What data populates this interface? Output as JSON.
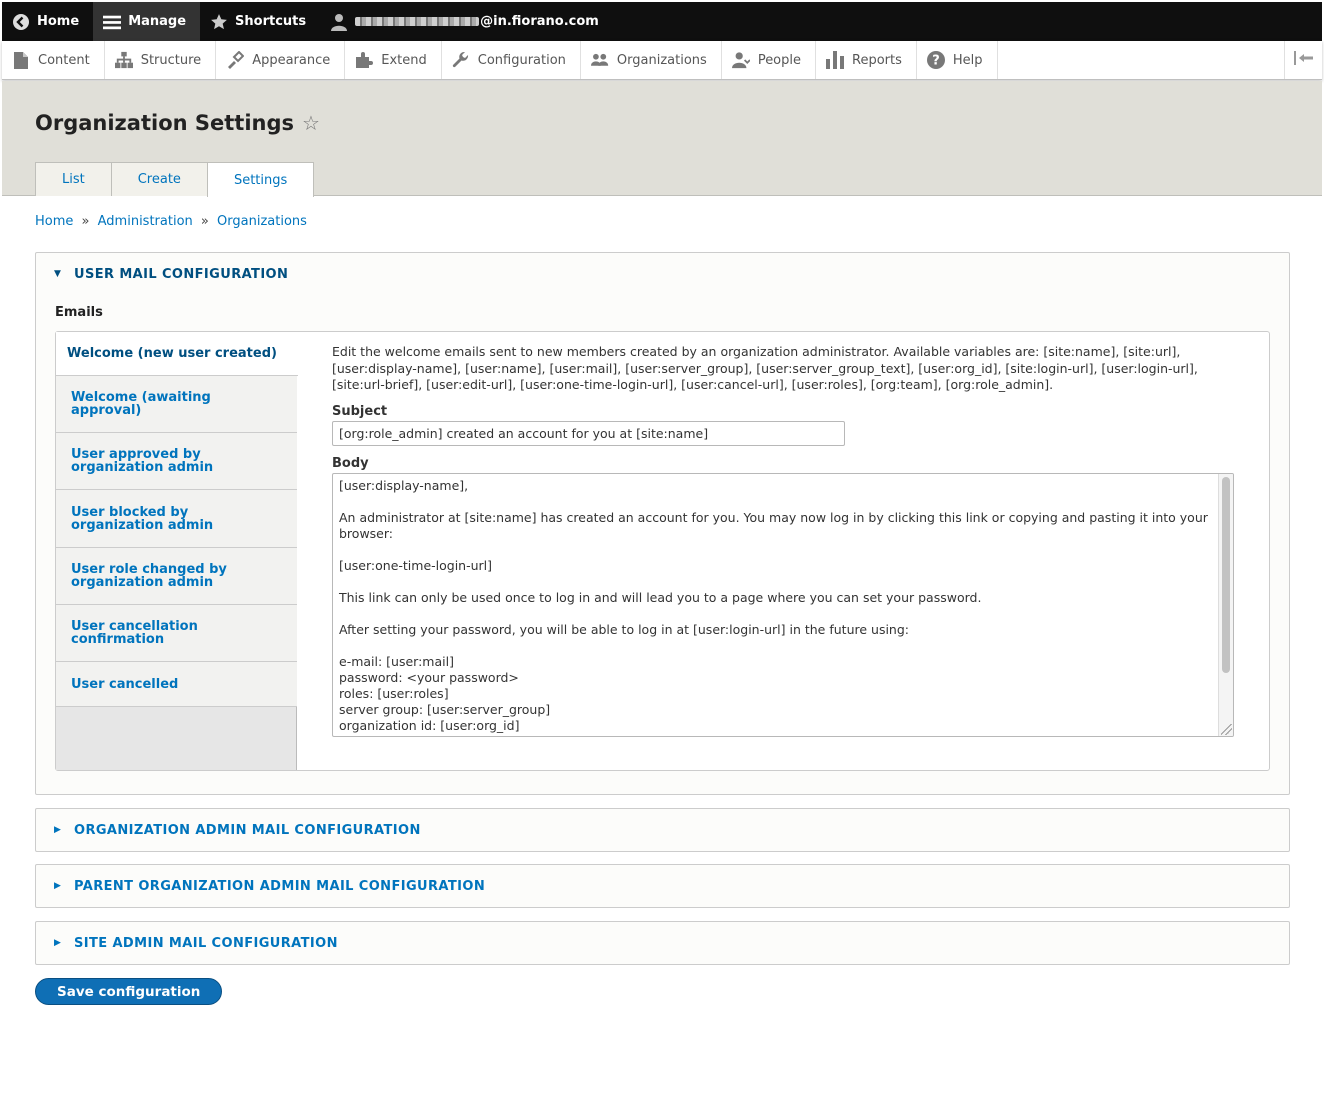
{
  "toolbar": {
    "home_label": "Home",
    "manage_label": "Manage",
    "shortcuts_label": "Shortcuts",
    "user_email_suffix": "@in.fiorano.com"
  },
  "tray": {
    "items": [
      {
        "label": "Content",
        "icon": "file-icon"
      },
      {
        "label": "Structure",
        "icon": "sitemap-icon"
      },
      {
        "label": "Appearance",
        "icon": "paintbrush-icon"
      },
      {
        "label": "Extend",
        "icon": "puzzle-icon"
      },
      {
        "label": "Configuration",
        "icon": "wrench-icon"
      },
      {
        "label": "Organizations",
        "icon": "people-group-icon"
      },
      {
        "label": "People",
        "icon": "person-icon"
      },
      {
        "label": "Reports",
        "icon": "bar-chart-icon"
      },
      {
        "label": "Help",
        "icon": "help-icon"
      }
    ]
  },
  "header": {
    "title": "Organization Settings",
    "tabs": [
      {
        "label": "List"
      },
      {
        "label": "Create"
      },
      {
        "label": "Settings"
      }
    ]
  },
  "breadcrumb": {
    "items": [
      "Home",
      "Administration",
      "Organizations"
    ],
    "separator": "»"
  },
  "user_mail": {
    "title": "USER MAIL CONFIGURATION",
    "emails_label": "Emails",
    "tabs": [
      {
        "label": "Welcome (new user created)"
      },
      {
        "label": "Welcome (awaiting approval)"
      },
      {
        "label": "User approved by organization admin"
      },
      {
        "label": "User blocked by organization admin"
      },
      {
        "label": "User role changed by organization admin"
      },
      {
        "label": "User cancellation confirmation"
      },
      {
        "label": "User cancelled"
      }
    ],
    "description": "Edit the welcome emails sent to new members created by an organization administrator. Available variables are: [site:name], [site:url], [user:display-name], [user:name], [user:mail], [user:server_group], [user:server_group_text], [user:org_id], [site:login-url], [user:login-url], [site:url-brief], [user:edit-url], [user:one-time-login-url], [user:cancel-url], [user:roles], [org:team], [org:role_admin].",
    "subject_label": "Subject",
    "subject_value": "[org:role_admin] created an account for you at [site:name]",
    "body_label": "Body",
    "body_value": "[user:display-name],\n\nAn administrator at [site:name] has created an account for you. You may now log in by clicking this link or copying and pasting it into your browser:\n\n[user:one-time-login-url]\n\nThis link can only be used once to log in and will lead you to a page where you can set your password.\n\nAfter setting your password, you will be able to log in at [user:login-url] in the future using:\n\ne-mail: [user:mail]\npassword: <your password>\nroles: [user:roles]\nserver group: [user:server_group]\norganization id: [user:org_id]"
  },
  "collapsed_sections": [
    {
      "title": "ORGANIZATION ADMIN MAIL CONFIGURATION"
    },
    {
      "title": "PARENT ORGANIZATION ADMIN MAIL CONFIGURATION"
    },
    {
      "title": "SITE ADMIN MAIL CONFIGURATION"
    }
  ],
  "actions": {
    "save_label": "Save configuration"
  },
  "colors": {
    "link": "#0074bd",
    "link_dark": "#004f80",
    "toolbar_bg": "#0f0f0f",
    "header_bg": "#e0dfd8",
    "button_bg": "#0f6fb5"
  }
}
